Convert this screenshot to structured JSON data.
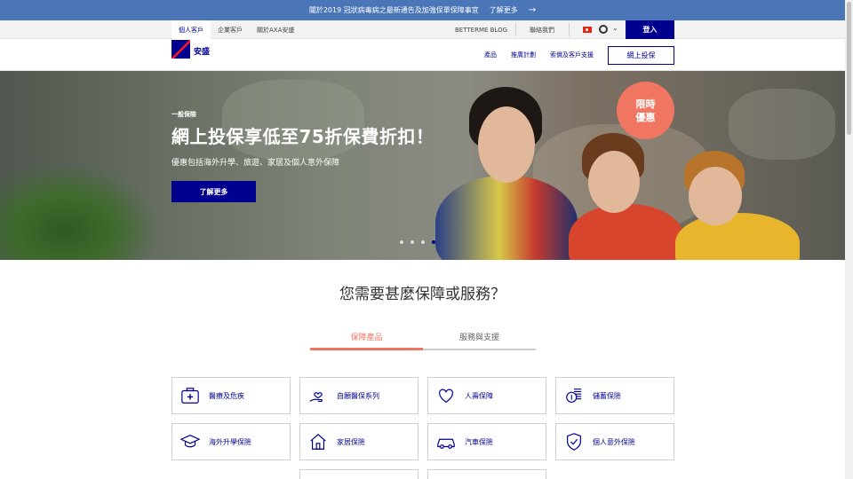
{
  "announcement": {
    "text": "關於2019 冠狀病毒病之最新通告及加強保單保障事宜",
    "link": "了解更多",
    "arrow": "→"
  },
  "utility_nav": {
    "tabs": [
      "個人客戶",
      "企業客戶",
      "關於AXA安盛"
    ],
    "blog": "BETTERME BLOG",
    "contact": "聯絡我們",
    "login": "登入"
  },
  "brand": {
    "name": "安盛",
    "logo_text": "AXA",
    "color": "#00008f",
    "accent": "#ff1721"
  },
  "main_nav": {
    "links": [
      "產品",
      "推廣計劃",
      "索償及客戶支援"
    ],
    "cta": "網上投保"
  },
  "hero": {
    "eyebrow": "一般保險",
    "title": "網上投保享低至75折保費折扣！",
    "subtitle": "優惠包括海外升學、旅遊、家居及個人意外保障",
    "cta": "了解更多",
    "badge_line1": "限時",
    "badge_line2": "優惠",
    "badge_color": "#f07662",
    "slides_total": 4,
    "slide_active": 4
  },
  "section": {
    "title": "您需要甚麼保障或服務？",
    "tabs": [
      "保障產品",
      "服務與支援"
    ],
    "active_tab": 0
  },
  "products": [
    {
      "label": "醫療及危疾",
      "icon": "medical-kit-icon"
    },
    {
      "label": "自願醫保系列",
      "icon": "hand-heart-icon"
    },
    {
      "label": "人壽保障",
      "icon": "heart-icon"
    },
    {
      "label": "儲蓄保險",
      "icon": "coins-icon"
    },
    {
      "label": "海外升學保險",
      "icon": "graduation-cap-icon"
    },
    {
      "label": "家居保險",
      "icon": "house-icon"
    },
    {
      "label": "汽車保險",
      "icon": "car-icon"
    },
    {
      "label": "個人意外保險",
      "icon": "shield-icon"
    }
  ]
}
